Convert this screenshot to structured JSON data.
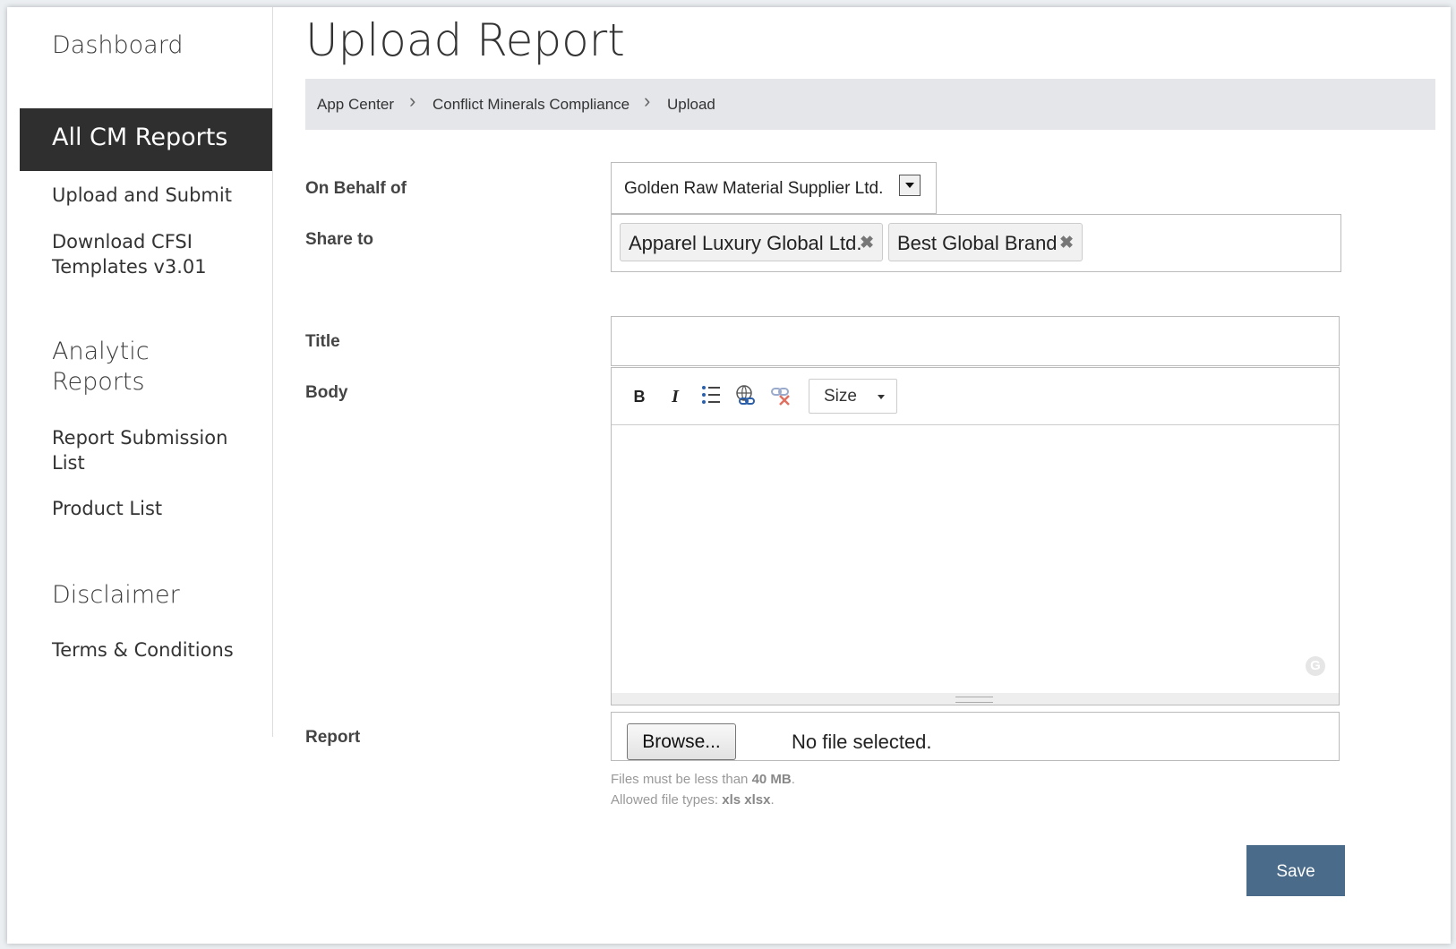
{
  "sidebar": {
    "dashboard": "Dashboard",
    "active_section": "All CM Reports",
    "upload_submit": "Upload and Submit",
    "download_templates": "Download CFSI Templates v3.01",
    "analytic_reports": "Analytic Reports",
    "report_submission_list": "Report Submission List",
    "product_list": "Product List",
    "disclaimer": "Disclaimer",
    "terms": "Terms & Conditions"
  },
  "page": {
    "title": "Upload Report"
  },
  "breadcrumb": {
    "items": [
      "App Center",
      "Conflict Minerals Compliance",
      "Upload"
    ]
  },
  "form": {
    "on_behalf_label": "On Behalf of",
    "on_behalf_value": "Golden Raw Material Supplier Ltd.",
    "share_to_label": "Share to",
    "share_tags": [
      "Apparel Luxury Global Ltd.",
      "Best Global Brand"
    ],
    "title_label": "Title",
    "title_value": "",
    "body_label": "Body",
    "toolbar": {
      "bold": "B",
      "italic": "I",
      "size": "Size"
    },
    "report_label": "Report",
    "browse_label": "Browse...",
    "file_status": "No file selected.",
    "help_size_prefix": "Files must be less than ",
    "help_size_value": "40 MB",
    "help_size_suffix": ".",
    "help_types_prefix": "Allowed file types: ",
    "help_types_value": "xls xlsx",
    "help_types_suffix": ".",
    "save_label": "Save"
  },
  "icons": {
    "bullet_list": "bullet-list-icon",
    "link": "link-icon",
    "unlink": "unlink-icon",
    "grammarly": "grammarly-icon"
  },
  "colors": {
    "active_nav_bg": "#2f2f2f",
    "breadcrumb_bg": "#e4e6ea",
    "save_button": "#4a6b8a"
  }
}
